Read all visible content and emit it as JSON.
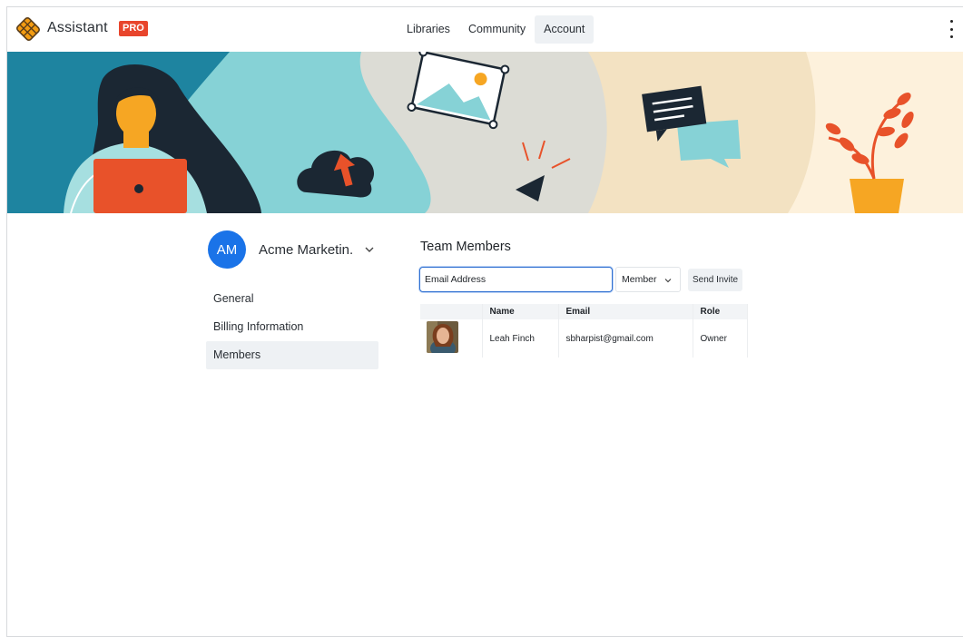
{
  "app": {
    "brand_name": "Assistant",
    "badge": "PRO",
    "accent_color": "#e8452c",
    "primary_color": "#1a73e8"
  },
  "nav": {
    "items": [
      {
        "label": "Libraries",
        "active": false
      },
      {
        "label": "Community",
        "active": false
      },
      {
        "label": "Account",
        "active": true
      }
    ],
    "menu_icon": "kebab-menu-icon"
  },
  "organization": {
    "initials": "AM",
    "name": "Acme Marketin...",
    "dropdown_icon": "chevron-down-icon"
  },
  "sidebar": {
    "items": [
      {
        "label": "General",
        "active": false
      },
      {
        "label": "Billing Information",
        "active": false
      },
      {
        "label": "Members",
        "active": true
      }
    ]
  },
  "members_section": {
    "title": "Team Members",
    "email_placeholder": "Email Address",
    "role_value": "Member",
    "send_label": "Send Invite",
    "table": {
      "columns": [
        "",
        "Name",
        "Email",
        "Role"
      ],
      "rows": [
        {
          "name": "Leah Finch",
          "email": "sbharpist@gmail.com",
          "role": "Owner"
        }
      ]
    }
  }
}
